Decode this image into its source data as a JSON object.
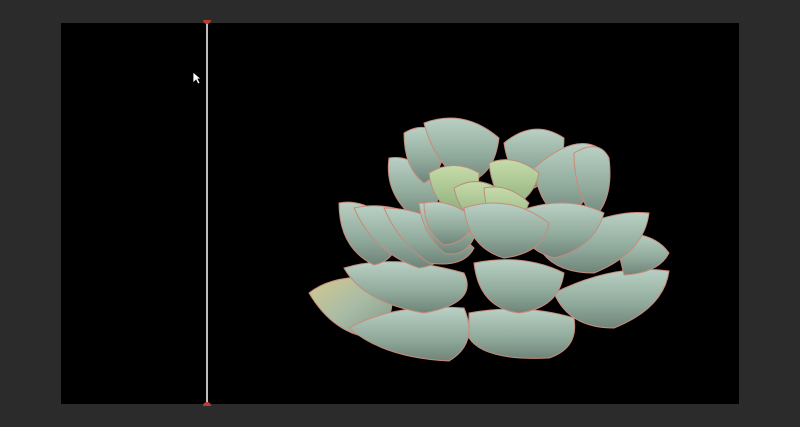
{
  "canvas": {
    "background": "#000000",
    "subject_icon": "succulent-plant-image"
  },
  "playhead": {
    "line_color": "#bdbdbd",
    "cap_color": "#c0392b"
  },
  "cursor": {
    "icon": "arrow-pointer-icon"
  }
}
